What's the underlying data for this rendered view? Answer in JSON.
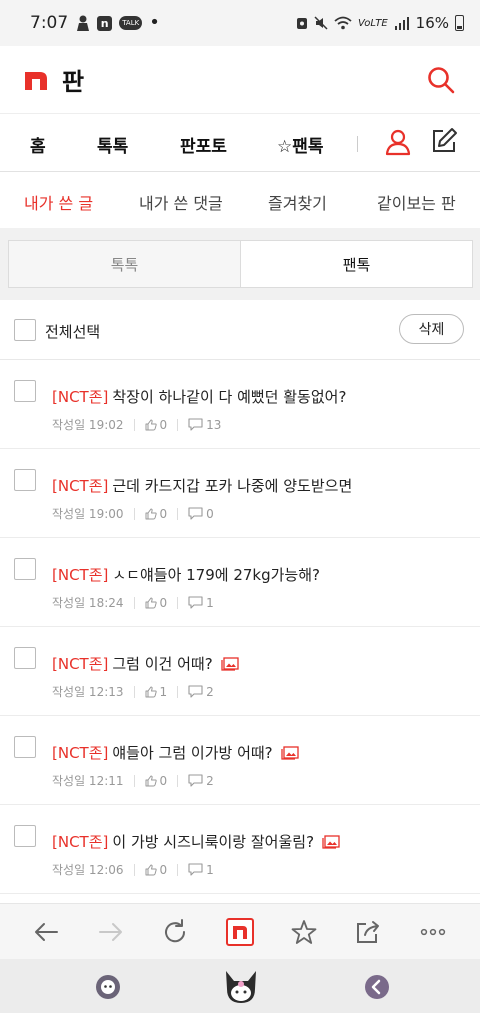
{
  "status_bar": {
    "time": "7:07",
    "talk_badge": "TALK",
    "network": "VoLTE",
    "battery": "16%"
  },
  "header": {
    "title": "판",
    "icons": [
      "n-logo-icon",
      "search-icon"
    ]
  },
  "main_nav": {
    "items": [
      "홈",
      "톡톡",
      "판포토",
      "☆팬톡"
    ]
  },
  "sub_tabs": {
    "items": [
      "내가 쓴 글",
      "내가 쓴 댓글",
      "즐겨찾기",
      "같이보는 판"
    ],
    "active_index": 0
  },
  "segment": {
    "left": "톡톡",
    "right": "팬톡",
    "selected": "팬톡"
  },
  "select_row": {
    "label": "전체선택",
    "delete_label": "삭제"
  },
  "posts": [
    {
      "tag": "[NCT존]",
      "title": "착장이 하나같이 다 예뻤던 활동없어?",
      "time": "작성일 19:02",
      "likes": "0",
      "comments": "13",
      "has_image": false
    },
    {
      "tag": "[NCT존]",
      "title": "근데 카드지갑 포카 나중에 양도받으면",
      "time": "작성일 19:00",
      "likes": "0",
      "comments": "0",
      "has_image": false
    },
    {
      "tag": "[NCT존]",
      "title": "ㅅㄷ얘들아 179에 27kg가능해?",
      "time": "작성일 18:24",
      "likes": "0",
      "comments": "1",
      "has_image": false
    },
    {
      "tag": "[NCT존]",
      "title": "그럼 이건 어때?",
      "time": "작성일 12:13",
      "likes": "1",
      "comments": "2",
      "has_image": true
    },
    {
      "tag": "[NCT존]",
      "title": "얘들아 그럼 이가방 어때?",
      "time": "작성일 12:11",
      "likes": "0",
      "comments": "2",
      "has_image": true
    },
    {
      "tag": "[NCT존]",
      "title": "이 가방 시즈니룩이랑 잘어울림?",
      "time": "작성일 12:06",
      "likes": "0",
      "comments": "1",
      "has_image": true
    }
  ],
  "browser_bar": {
    "icons": [
      "back-arrow-icon",
      "forward-arrow-icon",
      "refresh-icon",
      "n-home-icon",
      "star-icon",
      "share-icon",
      "more-icon"
    ]
  },
  "colors": {
    "accent": "#e8312a",
    "text": "#222222",
    "meta": "#999999"
  }
}
